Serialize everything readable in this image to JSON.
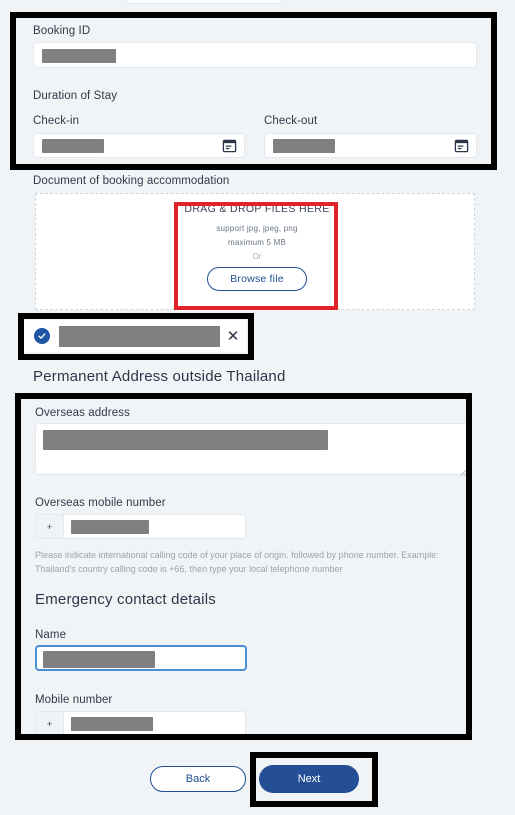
{
  "form": {
    "booking": {
      "label": "Booking ID",
      "value": ""
    },
    "duration": {
      "label": "Duration of Stay",
      "checkin_label": "Check-in",
      "checkin_value": "",
      "checkout_label": "Check-out",
      "checkout_value": "",
      "calendar_icon": "calendar-icon"
    },
    "document": {
      "label": "Document of booking accommodation",
      "dropzone_title": "DRAG & DROP FILES HERE",
      "support_text": "support jpg, jpeg, png",
      "size_text": "maximum 5 MB",
      "or_text": "Or",
      "browse_label": "Browse file",
      "uploaded_file": {
        "name": "",
        "status_icon": "check-circle-icon",
        "remove_icon": "close-icon",
        "remove_label": "✕"
      }
    },
    "permanent_address": {
      "title": "Permanent Address outside Thailand",
      "overseas_address_label": "Overseas address",
      "overseas_address_value": "",
      "overseas_mobile_label": "Overseas mobile number",
      "overseas_mobile_prefix": "+",
      "overseas_mobile_value": "",
      "hint": "Please indicate international calling code of your place of origin. followed by phone number. Example: Thailand's country calling code is +66, then type your local telephone number"
    },
    "emergency": {
      "title": "Emergency contact details",
      "name_label": "Name",
      "name_value": "",
      "mobile_label": "Mobile number",
      "mobile_prefix": "+",
      "mobile_value": ""
    }
  },
  "footer": {
    "back_label": "Back",
    "next_label": "Next"
  },
  "colors": {
    "page_background": "#f1f4f7",
    "primary_navy": "#244e96",
    "outline_navy": "#1f4f91",
    "label_text": "#2f3a4a",
    "hint_text": "#9aa3ae",
    "mask_gray": "#808080",
    "focus_blue": "#4a90d9",
    "annotation_black": "#000000",
    "annotation_red": "#e0242a",
    "field_border": "#e3e8ee"
  },
  "annotations": {
    "black_boxes": 4,
    "red_boxes": 1
  }
}
